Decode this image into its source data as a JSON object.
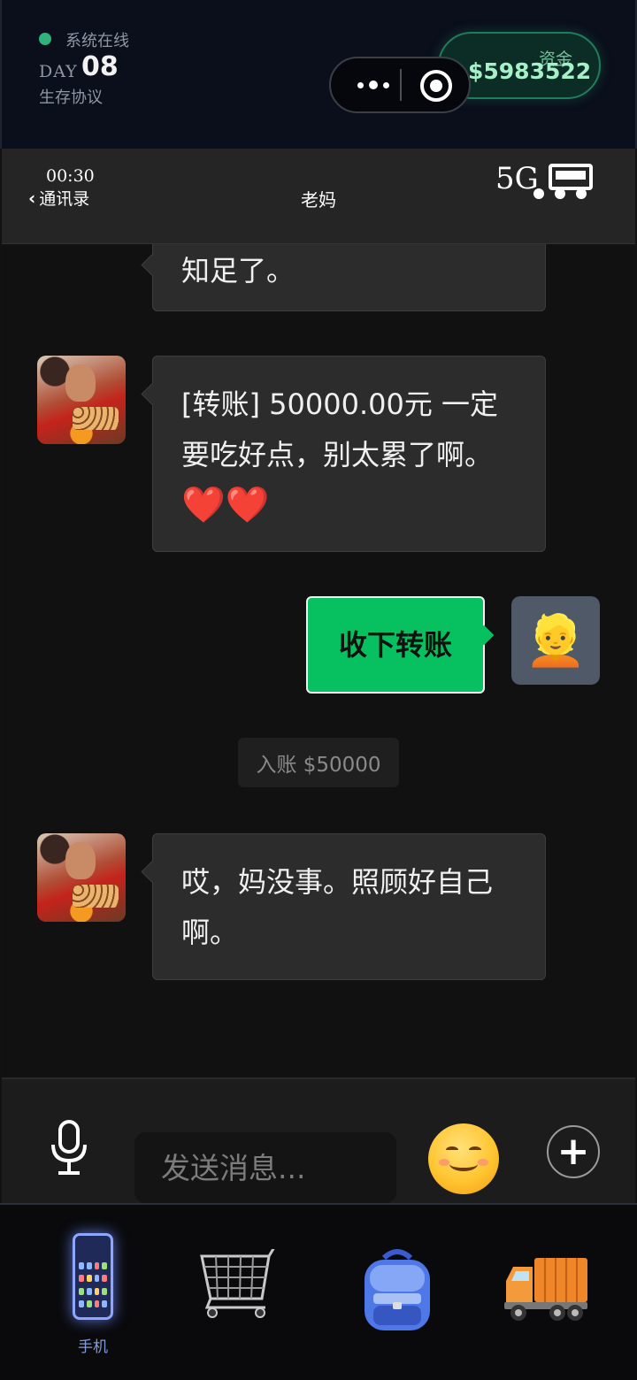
{
  "status": {
    "online_text": "系统在线",
    "day_label": "DAY",
    "day_number": "08",
    "protocol": "生存协议"
  },
  "funds": {
    "label": "资金",
    "value": "$5983522"
  },
  "phone": {
    "time": "00:30",
    "back_label": "通讯录",
    "network": "5G"
  },
  "chat": {
    "title": "老妈",
    "messages": [
      {
        "from": "mom",
        "text": "知足了。"
      },
      {
        "from": "mom",
        "text_line1": "[转账] 50000.00元 一定",
        "text_line2": "要吃好点，别太累了啊。",
        "hearts": "❤️❤️"
      },
      {
        "from": "me",
        "text": "收下转账"
      },
      {
        "from": "system",
        "text": "入账 $50000"
      },
      {
        "from": "mom",
        "text_line1": "哎，妈没事。照顾好自己",
        "text_line2": "啊。"
      }
    ],
    "me_avatar": "👱"
  },
  "input": {
    "placeholder": "发送消息..."
  },
  "nav": {
    "items": [
      {
        "label": "手机",
        "icon": "phone-icon",
        "active": true
      },
      {
        "label": "",
        "icon": "shopping-cart-icon",
        "active": false
      },
      {
        "label": "",
        "icon": "backpack-icon",
        "active": false
      },
      {
        "label": "",
        "icon": "truck-icon",
        "active": false
      }
    ]
  },
  "colors": {
    "accent_green": "#07c160",
    "online_dot": "#2eb37a",
    "funds_text": "#a6f0c7",
    "nav_active": "#7f9bdc"
  }
}
